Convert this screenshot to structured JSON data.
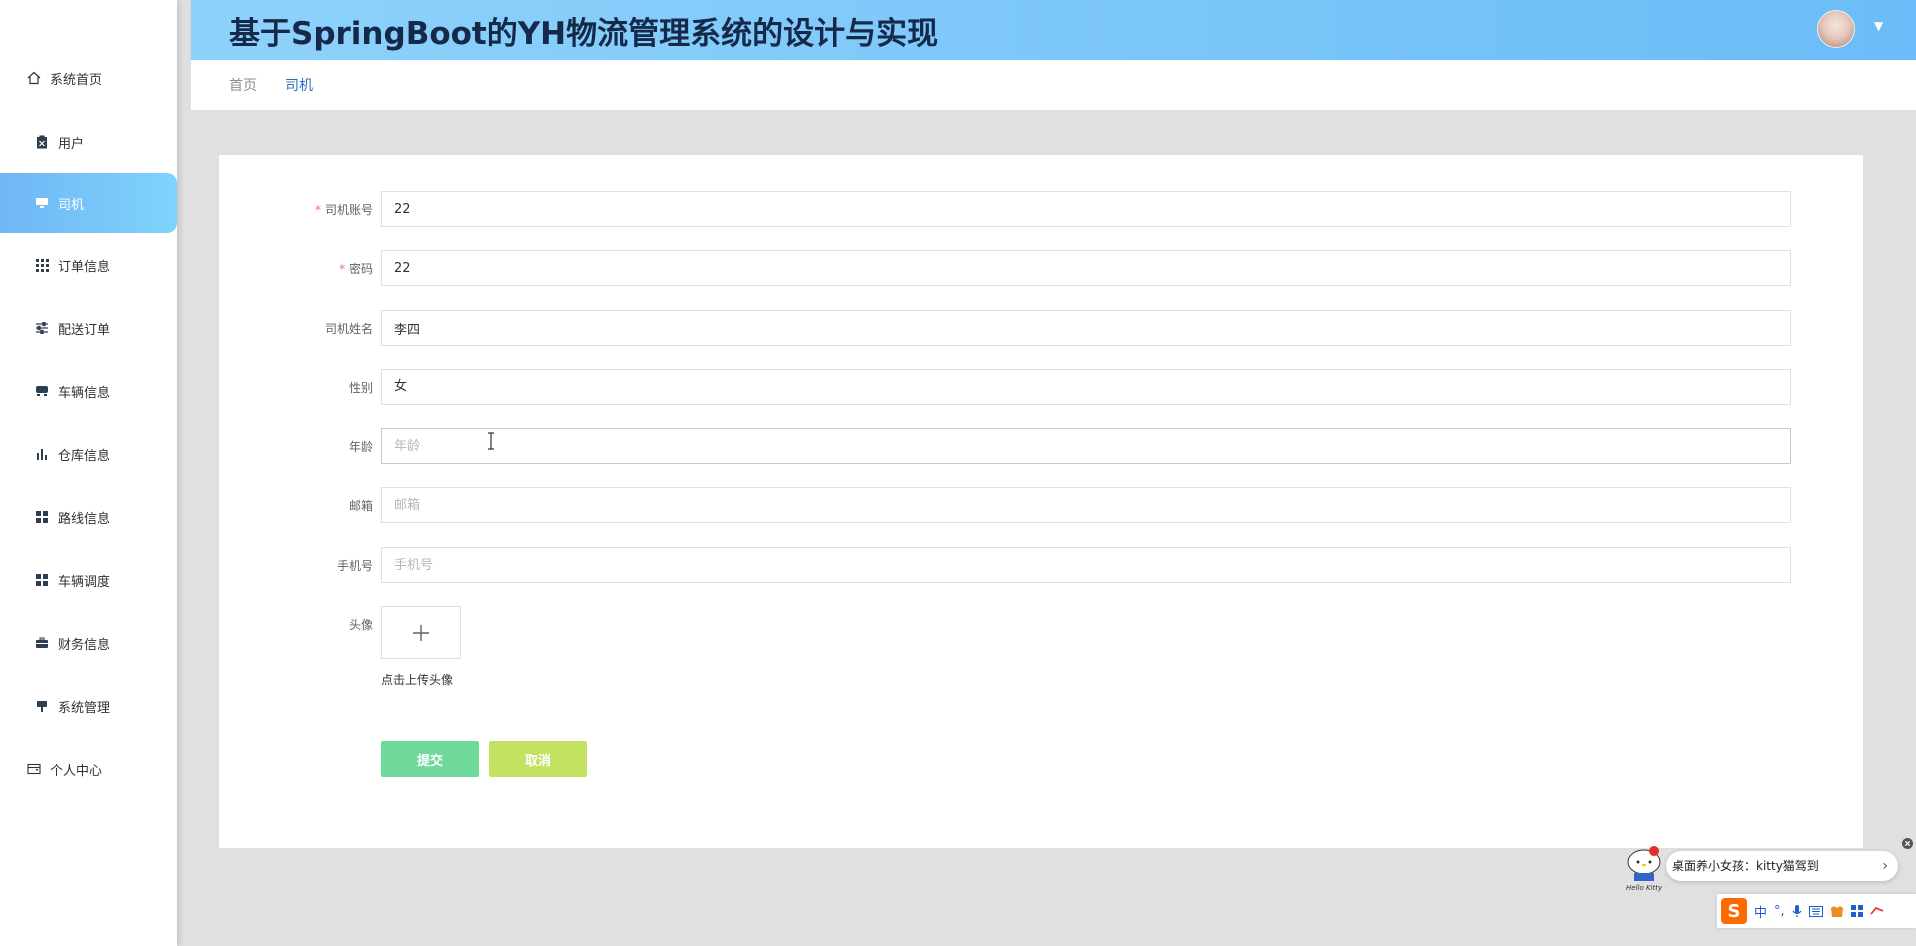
{
  "header": {
    "title": "基于SpringBoot的YH物流管理系统的设计与实现"
  },
  "breadcrumb": {
    "home": "首页",
    "current": "司机"
  },
  "sidebar": {
    "items": [
      {
        "label": "系统首页",
        "icon": "home-icon"
      },
      {
        "label": "用户",
        "icon": "clipboard-icon"
      },
      {
        "label": "司机",
        "icon": "monitor-icon",
        "active": true
      },
      {
        "label": "订单信息",
        "icon": "grid-icon"
      },
      {
        "label": "配送订单",
        "icon": "sliders-icon"
      },
      {
        "label": "车辆信息",
        "icon": "vehicle-icon"
      },
      {
        "label": "仓库信息",
        "icon": "bar-chart-icon"
      },
      {
        "label": "路线信息",
        "icon": "tiles-icon"
      },
      {
        "label": "车辆调度",
        "icon": "tiles-icon"
      },
      {
        "label": "财务信息",
        "icon": "briefcase-icon"
      },
      {
        "label": "系统管理",
        "icon": "stamp-icon"
      },
      {
        "label": "个人中心",
        "icon": "wallet-icon"
      }
    ]
  },
  "form": {
    "account": {
      "label": "司机账号",
      "value": "22",
      "required": true
    },
    "password": {
      "label": "密码",
      "value": "22",
      "required": true
    },
    "name": {
      "label": "司机姓名",
      "value": "李四"
    },
    "gender": {
      "label": "性别",
      "value": "女"
    },
    "age": {
      "label": "年龄",
      "value": "",
      "placeholder": "年龄"
    },
    "email": {
      "label": "邮箱",
      "value": "",
      "placeholder": "邮箱"
    },
    "phone": {
      "label": "手机号",
      "value": "",
      "placeholder": "手机号"
    },
    "avatar": {
      "label": "头像",
      "hint": "点击上传头像"
    },
    "required_mark": "*",
    "submit_label": "提交",
    "cancel_label": "取消"
  },
  "notice": {
    "text": "桌面养小女孩：kitty猫驾到",
    "brand": "Hello Kitty",
    "arrow": "›"
  },
  "ime": {
    "logo": "S",
    "mode": "中",
    "punct": "°,"
  },
  "colors": {
    "header_gradient_start": "#8ed2fb",
    "header_gradient_end": "#6bbcf8",
    "active_nav": "#6fb6f6",
    "submit": "#6fd99a",
    "cancel": "#c3e262",
    "breadcrumb_current": "#2b6fbd",
    "required": "#f56c6c"
  }
}
